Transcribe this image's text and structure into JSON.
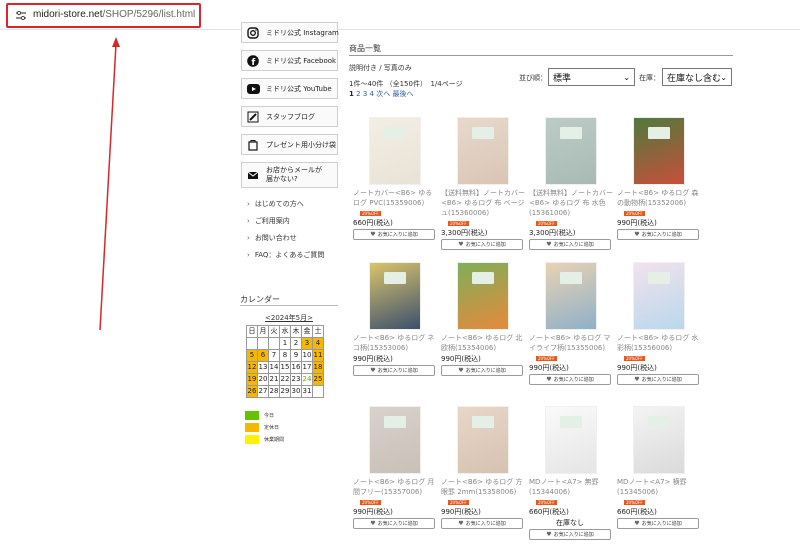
{
  "browser": {
    "url_host": "midori-store.net",
    "url_path": "/SHOP/5296/list.html"
  },
  "sidebar": {
    "social": [
      {
        "label": "ミドリ公式 Instagram",
        "icon": "instagram-icon"
      },
      {
        "label": "ミドリ公式 Facebook",
        "icon": "facebook-icon"
      },
      {
        "label": "ミドリ公式 YouTube",
        "icon": "youtube-icon"
      },
      {
        "label": "スタッフブログ",
        "icon": "pencil-icon"
      },
      {
        "label": "プレゼント用小分け袋",
        "icon": "bag-icon"
      },
      {
        "label_line1": "お店からメールが",
        "label_line2": "届かない?",
        "icon": "mail-icon"
      }
    ],
    "links": [
      "はじめての方へ",
      "ご利用案内",
      "お問い合わせ",
      "FAQ：よくあるご質問"
    ],
    "calendar": {
      "title": "カレンダー",
      "month": "<2024年5月>",
      "weekdays": [
        "日",
        "月",
        "火",
        "水",
        "木",
        "金",
        "土"
      ],
      "weeks": [
        [
          "",
          "",
          "",
          "1",
          "2",
          "3",
          "4"
        ],
        [
          "5",
          "6",
          "7",
          "8",
          "9",
          "10",
          "11"
        ],
        [
          "12",
          "13",
          "14",
          "15",
          "16",
          "17",
          "18"
        ],
        [
          "19",
          "20",
          "21",
          "22",
          "23",
          "24",
          "25"
        ],
        [
          "26",
          "27",
          "28",
          "29",
          "30",
          "31",
          ""
        ]
      ],
      "holidays": [
        "3",
        "4",
        "5",
        "6",
        "11",
        "12",
        "18",
        "19",
        "25",
        "26"
      ],
      "today": "24",
      "legend": [
        {
          "label": "今日",
          "color": "#66c200"
        },
        {
          "label": "定休日",
          "color": "#f5b700"
        },
        {
          "label": "休業期間",
          "color": "#fff200"
        }
      ]
    }
  },
  "main": {
    "section_title": "商品一覧",
    "filters": "説明付き / 写真のみ",
    "count": "1件～40件 （全150件）　1/4ページ",
    "pager": {
      "current": "1",
      "pages": [
        "2",
        "3",
        "4"
      ],
      "next": "次へ",
      "last": "最後へ"
    },
    "sort_label": "並び順：",
    "sort_value": "標準",
    "stock_label": "在庫：",
    "stock_value": "在庫なし含む",
    "fav_label": "お気に入りに追加",
    "products": [
      {
        "name": "ノートカバー<B6> ゆるログ PVC(15359006)",
        "badge": "20%OFF",
        "price": "660円(税込)",
        "color": "#f3eee4",
        "accent": "#e9e3d6"
      },
      {
        "name": "【送料無料】ノートカバー<B6> ゆるログ 布 ベージュ(15360006)",
        "badge": "20%OFF",
        "price": "3,300円(税込)",
        "color": "#e8d9cc",
        "accent": "#d9c5b4"
      },
      {
        "name": "【送料無料】ノートカバー<B6> ゆるログ 布 水色 (15361006)",
        "badge": "20%OFF",
        "price": "3,300円(税込)",
        "color": "#bccbc6",
        "accent": "#a9bab4"
      },
      {
        "name": "ノート<B6> ゆるログ 森の動物柄(15352006)",
        "badge": "20%OFF",
        "price": "990円(税込)",
        "color": "#4f7a3e",
        "accent": "#c84f3a"
      },
      {
        "name": "ノート<B6> ゆるログ ネコ柄(15353006)",
        "badge": "",
        "price": "990円(税込)",
        "color": "#d9c46a",
        "accent": "#3c4f6e"
      },
      {
        "name": "ノート<B6> ゆるログ 北欧柄(15354006)",
        "badge": "",
        "price": "990円(税込)",
        "color": "#7fae5a",
        "accent": "#e68a3c"
      },
      {
        "name": "ノート<B6> ゆるログ マイライフ柄(15355006)",
        "badge": "20%OFF",
        "price": "990円(税込)",
        "color": "#e9d2b4",
        "accent": "#8fb0c8"
      },
      {
        "name": "ノート<B6> ゆるログ 水彩柄(15356006)",
        "badge": "20%OFF",
        "price": "990円(税込)",
        "color": "#f2e2ec",
        "accent": "#b9d8ec"
      },
      {
        "name": "ノート<B6> ゆるログ 月間フリー(15357006)",
        "badge": "20%OFF",
        "price": "990円(税込)",
        "color": "#d9d2cb",
        "accent": "#c9c0b7"
      },
      {
        "name": "ノート<B6> ゆるログ 方眼罫 2mm(15358006)",
        "badge": "20%OFF",
        "price": "990円(税込)",
        "color": "#e7d7c9",
        "accent": "#d6c2b0"
      },
      {
        "name": "MDノート<A7> 無罫 (15344006)",
        "badge": "20%OFF",
        "price": "660円(税込)",
        "soldout": "在庫なし",
        "color": "#fafafa",
        "accent": "#e5e5e5"
      },
      {
        "name": "MDノート<A7> 横罫 (15345006)",
        "badge": "20%OFF",
        "price": "660円(税込)",
        "color": "#f4f4f4",
        "accent": "#dadada"
      }
    ]
  }
}
